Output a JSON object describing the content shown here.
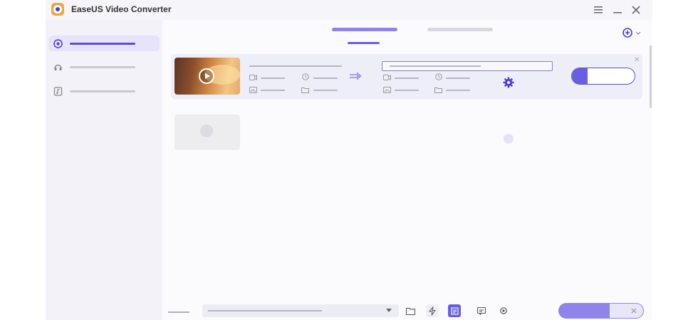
{
  "titlebar": {
    "app_title": "EaseUS Video Converter",
    "logo_icon": "easeus-logo-icon",
    "controls": [
      "menu-icon",
      "minimize-icon",
      "close-icon"
    ]
  },
  "sidebar": {
    "items": [
      {
        "icon": "video-converter-icon",
        "active": true
      },
      {
        "icon": "audio-converter-icon",
        "active": false
      },
      {
        "icon": "music-file-icon",
        "active": false
      }
    ]
  },
  "tabs": {
    "active_index": 0,
    "count": 2
  },
  "toolbar": {
    "add_icon": "add-file-icon",
    "dropdown_icon": "chevron-down-icon"
  },
  "file_card": {
    "thumbnail_icon": "play-icon",
    "source_meta_icons": [
      "video-icon",
      "clock-icon",
      "resolution-icon",
      "folder-icon"
    ],
    "arrow_icon": "convert-arrow-icon",
    "output_meta_icons": [
      "video-icon",
      "clock-icon",
      "resolution-icon",
      "folder-icon"
    ],
    "settings_icon": "gear-icon",
    "close_icon": "close-icon",
    "convert_progress": 0.25
  },
  "bottom_bar": {
    "icons": [
      "folder-icon",
      "gpu-acceleration-icon",
      "merge-icon",
      "subtitle-icon",
      "settings-icon"
    ],
    "dropdown_icon": "dropdown-arrow-icon",
    "start_all_progress": 0.6
  },
  "colors": {
    "accent": "#6a5ee0",
    "accent_dark": "#4a3ad9",
    "sidebar_bg": "#f2f2f8",
    "card_bg": "#eeeef8"
  }
}
